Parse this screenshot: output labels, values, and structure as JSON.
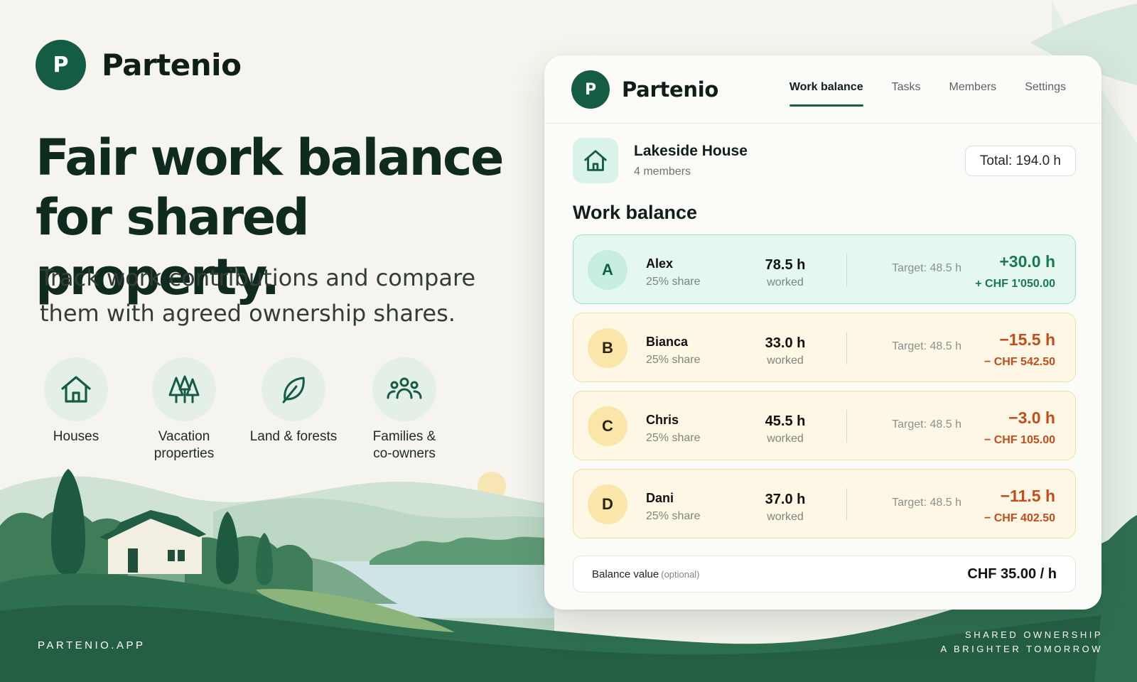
{
  "hero": {
    "brand": "Partenio",
    "logo_letter": "P",
    "headline_line1": "Fair work balance",
    "headline_line2": "for shared property.",
    "subline_line1": "Track work contributions and compare",
    "subline_line2": "them with agreed ownership shares.",
    "features": [
      {
        "icon": "house-icon",
        "line1": "Houses",
        "line2": ""
      },
      {
        "icon": "trees-icon",
        "line1": "Vacation",
        "line2": "properties"
      },
      {
        "icon": "leaf-icon",
        "line1": "Land & forests",
        "line2": ""
      },
      {
        "icon": "people-icon",
        "line1": "Families &",
        "line2": "co-owners"
      }
    ],
    "footer_left": "PARTENIO.APP",
    "footer_right_line1": "SHARED OWNERSHIP",
    "footer_right_line2": "A BRIGHTER TOMORROW"
  },
  "app": {
    "logo_letter": "P",
    "title": "Partenio",
    "tabs": [
      "Work balance",
      "Tasks",
      "Members",
      "Settings"
    ],
    "active_tab": "Work balance",
    "property": {
      "name": "Lakeside House",
      "members": "4 members",
      "total": "Total: 194.0 h"
    },
    "section_title": "Work balance",
    "members": [
      {
        "initial": "A",
        "name": "Alex",
        "share": "25% share",
        "hours": "78.5 h",
        "worked": "worked",
        "target": "Target: 48.5 h",
        "delta": "+30.0 h",
        "value": "+ CHF 1'050.00",
        "status": "positive"
      },
      {
        "initial": "B",
        "name": "Bianca",
        "share": "25% share",
        "hours": "33.0 h",
        "worked": "worked",
        "target": "Target: 48.5 h",
        "delta": "−15.5 h",
        "value": "− CHF 542.50",
        "status": "negative"
      },
      {
        "initial": "C",
        "name": "Chris",
        "share": "25% share",
        "hours": "45.5 h",
        "worked": "worked",
        "target": "Target: 48.5 h",
        "delta": "−3.0 h",
        "value": "− CHF 105.00",
        "status": "negative"
      },
      {
        "initial": "D",
        "name": "Dani",
        "share": "25% share",
        "hours": "37.0 h",
        "worked": "worked",
        "target": "Target: 48.5 h",
        "delta": "−11.5 h",
        "value": "− CHF 402.50",
        "status": "negative"
      }
    ],
    "balance": {
      "label": "Balance value",
      "optional": "(optional)",
      "value": "CHF 35.00 / h"
    }
  },
  "colors": {
    "brand_green": "#145c43",
    "positive": "#1a7a4f",
    "negative": "#c24d1a",
    "background": "#f5f4ee"
  }
}
